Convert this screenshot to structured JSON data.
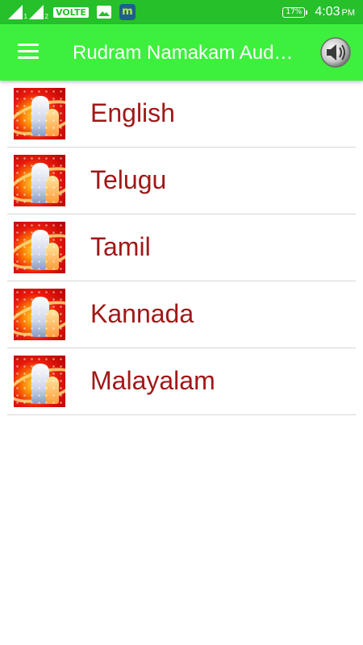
{
  "status_bar": {
    "sim1_label": "1",
    "sim2_label": "2",
    "volte_label": "VOLTE",
    "battery_label": "17%",
    "time": "4:03",
    "ampm": "PM"
  },
  "app_bar": {
    "title": "Rudram Namakam Aud…",
    "menu_icon": "hamburger-menu-icon",
    "speaker_icon": "speaker-icon"
  },
  "languages": [
    {
      "label": "English"
    },
    {
      "label": "Telugu"
    },
    {
      "label": "Tamil"
    },
    {
      "label": "Kannada"
    },
    {
      "label": "Malayalam"
    }
  ],
  "colors": {
    "status_bar": "#25c02a",
    "app_bar": "#3ef03e",
    "item_text": "#a01818"
  }
}
